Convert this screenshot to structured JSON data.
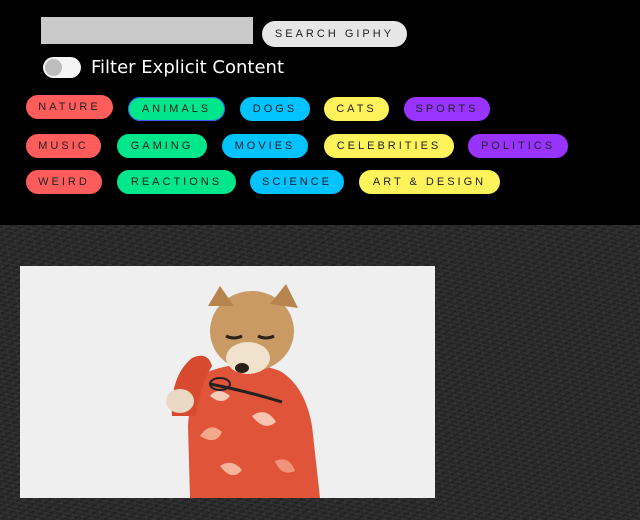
{
  "search": {
    "value": "",
    "placeholder": "",
    "button_label": "SEARCH GIPHY"
  },
  "filter": {
    "label": "Filter Explicit Content",
    "enabled": false
  },
  "categories": [
    {
      "label": "NATURE",
      "color": "#ff5c5c"
    },
    {
      "label": "ANIMALS",
      "color": "#00e68a"
    },
    {
      "label": "DOGS",
      "color": "#00c3ff"
    },
    {
      "label": "CATS",
      "color": "#fff35c"
    },
    {
      "label": "SPORTS",
      "color": "#9933ff"
    },
    {
      "label": "MUSIC",
      "color": "#ff5c5c"
    },
    {
      "label": "GAMING",
      "color": "#00e68a"
    },
    {
      "label": "MOVIES",
      "color": "#00c3ff"
    },
    {
      "label": "CELEBRITIES",
      "color": "#fff35c"
    },
    {
      "label": "POLITICS",
      "color": "#9933ff"
    },
    {
      "label": "WEIRD",
      "color": "#ff5c5c"
    },
    {
      "label": "REACTIONS",
      "color": "#00e68a"
    },
    {
      "label": "SCIENCE",
      "color": "#00c3ff"
    },
    {
      "label": "ART & DESIGN",
      "color": "#fff35c"
    }
  ],
  "focused_category": "ANIMALS",
  "results": [
    {
      "icon": "shiba-dog-gif-image"
    }
  ]
}
